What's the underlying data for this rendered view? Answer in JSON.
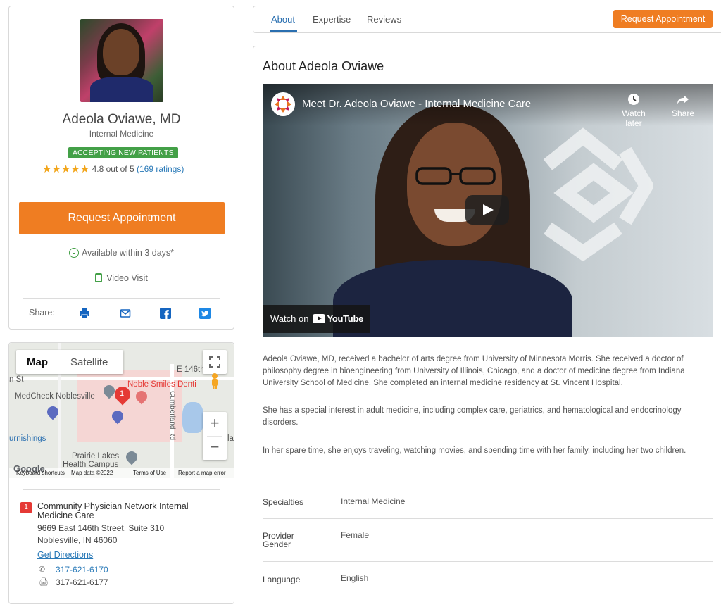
{
  "profile": {
    "name": "Adeola Oviawe, MD",
    "specialty": "Internal Medicine",
    "badge": "ACCEPTING NEW PATIENTS",
    "stars": "★★★★★",
    "rating_text": "4.8 out of 5",
    "ratings_link": "(169 ratings)",
    "request_label": "Request Appointment",
    "availability": "Available within 3 days*",
    "video_visit": "Video Visit",
    "share_label": "Share:"
  },
  "map": {
    "tab_map": "Map",
    "tab_satellite": "Satellite",
    "labels": {
      "street_e146": "E 146th",
      "st": "n St",
      "medcheck": "MedCheck Noblesville",
      "noble_smiles": "Noble Smiles Denti",
      "furnishings": "urnishings",
      "prairie1": "Prairie Lakes",
      "prairie2": "Health Campus",
      "cumberland": "Cumberland Rd",
      "la": "la"
    },
    "footer": {
      "google": "Google",
      "shortcuts": "Keyboard shortcuts",
      "data": "Map data ©2022",
      "terms": "Terms of Use",
      "report": "Report a map error"
    },
    "pin_number": "1",
    "zoom_in": "+",
    "zoom_out": "−"
  },
  "location": {
    "number": "1",
    "name": "Community Physician Network Internal Medicine Care",
    "address1": "9669 East 146th Street, Suite 310",
    "address2": "Noblesville, IN 46060",
    "directions": "Get Directions",
    "phone": "317-621-6170",
    "fax": "317-621-6177"
  },
  "tabs": {
    "about": "About",
    "expertise": "Expertise",
    "reviews": "Reviews",
    "request_label": "Request Appointment"
  },
  "about": {
    "title": "About Adeola Oviawe",
    "video_title": "Meet Dr. Adeola Oviawe - Internal Medicine Care",
    "watch_later": "Watch later",
    "share": "Share",
    "watch_on": "Watch on",
    "youtube": "YouTube",
    "paragraphs": [
      "Adeola Oviawe, MD, received a bachelor of arts degree from University of Minnesota Morris. She received a doctor of philosophy degree in bioengineering from University of Illinois, Chicago, and a doctor of medicine degree from Indiana University School of Medicine. She completed an internal medicine residency at St. Vincent Hospital.",
      "She has a special interest in adult medicine, including complex care, geriatrics, and hematological and endocrinology disorders.",
      "In her spare time, she enjoys traveling, watching movies, and spending time with her family, including her two children."
    ],
    "details": [
      {
        "key": "Specialties",
        "value": "Internal Medicine"
      },
      {
        "key": "Provider Gender",
        "value": "Female"
      },
      {
        "key": "Language",
        "value": "English"
      }
    ]
  },
  "colors": {
    "accent_orange": "#ef7d22",
    "link_blue": "#2a7ab8",
    "badge_green": "#43a047",
    "star_gold": "#f2a51a"
  }
}
